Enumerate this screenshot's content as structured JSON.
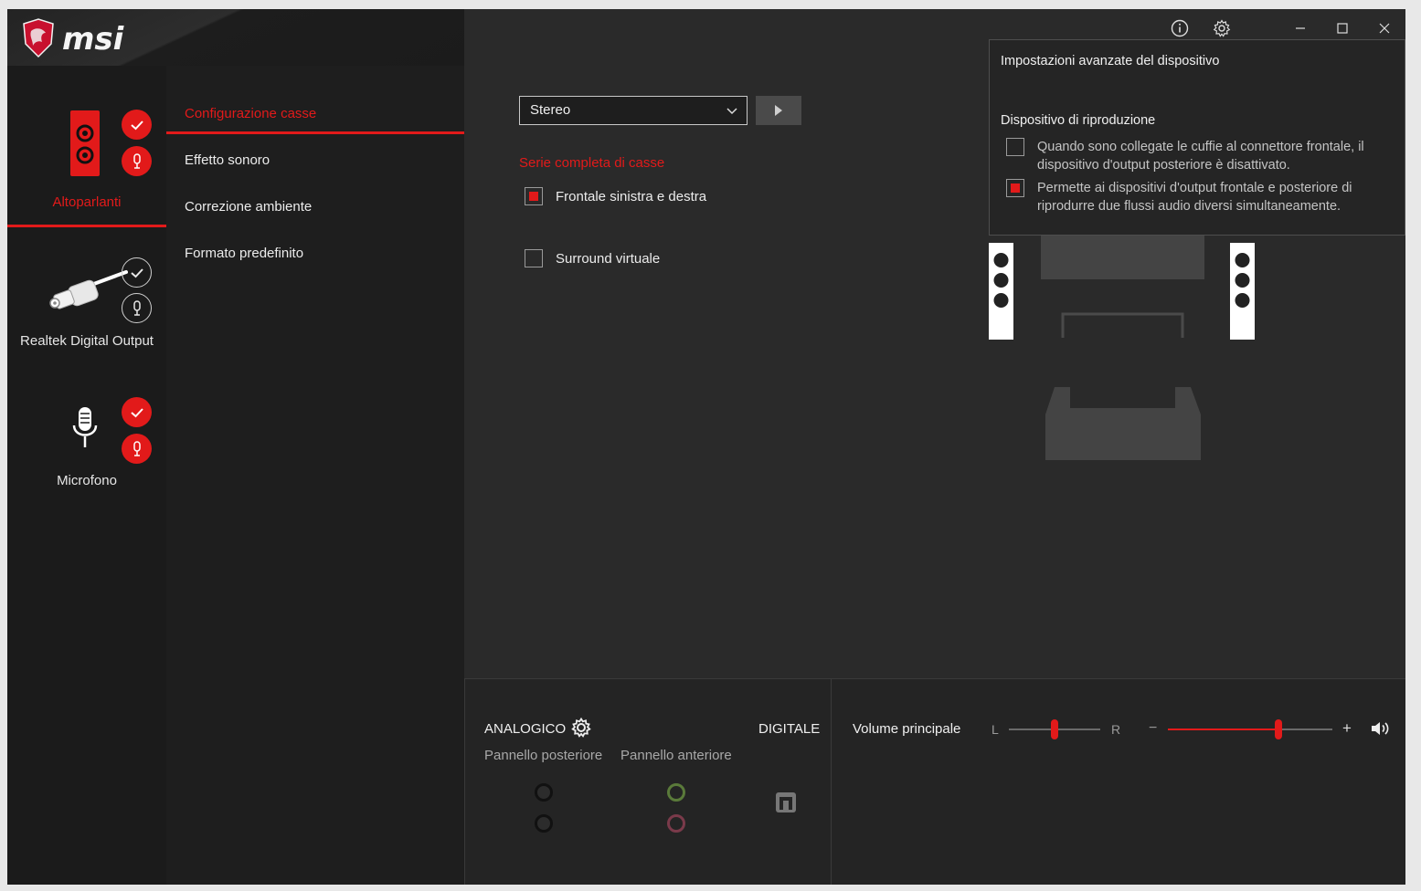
{
  "app": {
    "brand": "msi",
    "title_buttons": [
      "info-icon",
      "gear-icon",
      "minimize-icon",
      "maximize-icon",
      "close-icon"
    ]
  },
  "devices": [
    {
      "label": "Altoparlanti",
      "active": true,
      "default_badge": "check",
      "comm_badge": "mic"
    },
    {
      "label": "Realtek Digital Output",
      "active": false,
      "default_badge": "check",
      "comm_badge": "mic"
    },
    {
      "label": "Microfono",
      "active": false,
      "default_badge": "check",
      "comm_badge": "mic"
    }
  ],
  "menu": {
    "items": [
      {
        "label": "Configurazione casse",
        "active": true
      },
      {
        "label": "Effetto sonoro",
        "active": false
      },
      {
        "label": "Correzione ambiente",
        "active": false
      },
      {
        "label": "Formato predefinito",
        "active": false
      }
    ]
  },
  "config": {
    "speaker_mode": "Stereo",
    "section_title": "Serie completa di casse",
    "options": [
      {
        "label": "Frontale sinistra e destra",
        "checked": true
      },
      {
        "label": "Surround virtuale",
        "checked": false
      }
    ]
  },
  "advanced": {
    "title": "Impostazioni avanzate del dispositivo",
    "subtitle": "Dispositivo di riproduzione",
    "options": [
      {
        "label": "Quando sono collegate le cuffie al connettore frontale, il dispositivo d'output posteriore è disattivato.",
        "checked": false
      },
      {
        "label": "Permette ai dispositivi d'output frontale e posteriore di riprodurre due flussi audio diversi simultaneamente.",
        "checked": true
      }
    ]
  },
  "bottom": {
    "analog_label": "ANALOGICO",
    "digital_label": "DIGITALE",
    "rear_panel": "Pannello posteriore",
    "front_panel": "Pannello anteriore",
    "volume_label": "Volume principale",
    "balance_left": "L",
    "balance_right": "R",
    "volume_minus": "−",
    "volume_plus": "+",
    "balance_value": 0.5,
    "volume_value": 0.67,
    "jack_colors": {
      "rear_top": "#111111",
      "rear_bottom": "#111111",
      "front_top": "#5a7a3a",
      "front_bottom": "#7a3a4a"
    }
  },
  "colors": {
    "accent": "#e21a1a",
    "background": "#2a2a2a",
    "sidebar": "#1b1b1b"
  }
}
